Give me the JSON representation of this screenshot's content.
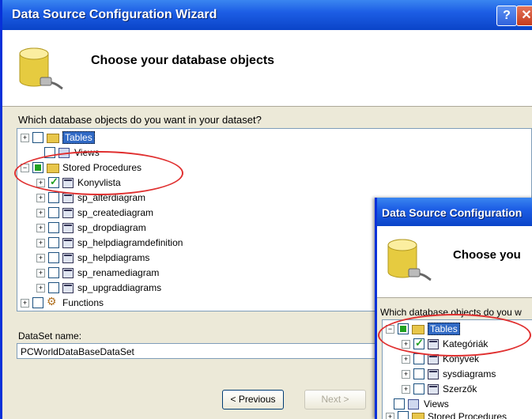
{
  "main": {
    "title": "Data Source Configuration Wizard",
    "help_label": "?",
    "close_label": "✕",
    "header_title": "Choose your database objects",
    "prompt": "Which database objects do you want in your dataset?",
    "tree": {
      "tables": "Tables",
      "views": "Views",
      "stored_procedures": "Stored Procedures",
      "procedures": [
        "Konyvlista",
        "sp_alterdiagram",
        "sp_creatediagram",
        "sp_dropdiagram",
        "sp_helpdiagramdefinition",
        "sp_helpdiagrams",
        "sp_renamediagram",
        "sp_upgraddiagrams"
      ],
      "functions": "Functions"
    },
    "dataset_label": "DataSet name:",
    "dataset_value": "PCWorldDataBaseDataSet",
    "prev_button": "< Previous",
    "next_button": "Next >"
  },
  "second": {
    "title": "Data Source Configuration",
    "header_title": "Choose you",
    "prompt": "Which database objects do you w",
    "tree": {
      "tables": "Tables",
      "items": [
        "Kategóriák",
        "Konyvek",
        "sysdiagrams",
        "Szerzők"
      ],
      "views": "Views",
      "stored_procedures": "Stored Procedures"
    }
  },
  "colors": {
    "highlight": "#e03030",
    "titlebar": "#0a44c8",
    "checked": "#21a121"
  }
}
